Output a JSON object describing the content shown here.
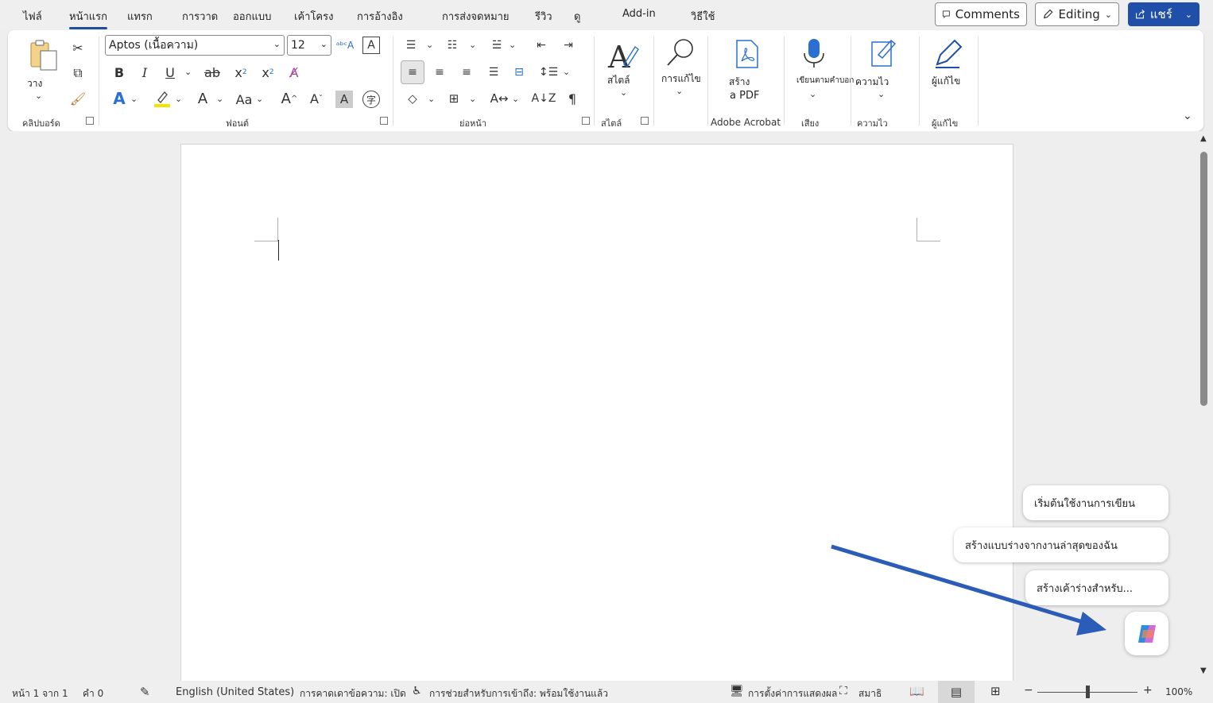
{
  "tabs": [
    {
      "label": "ไฟล์"
    },
    {
      "label": "หน้าแรก"
    },
    {
      "label": "แทรก"
    },
    {
      "label": "การวาด"
    },
    {
      "label": "ออกแบบ"
    },
    {
      "label": "เค้าโครง"
    },
    {
      "label": "การอ้างอิง"
    },
    {
      "label": "การส่งจดหมาย"
    },
    {
      "label": "รีวิว"
    },
    {
      "label": "ดู"
    },
    {
      "label": "Add-in"
    },
    {
      "label": "วิธีใช้"
    }
  ],
  "top_buttons": {
    "comments": "Comments",
    "editing": "Editing",
    "share": "แชร์"
  },
  "ribbon": {
    "clipboard": {
      "paste": "วาง",
      "label": "คลิปบอร์ด"
    },
    "font": {
      "name": "Aptos (เนื้อความ)",
      "size": "12",
      "label": "ฟอนต์"
    },
    "paragraph": {
      "label": "ย่อหน้า"
    },
    "styles": {
      "button": "สไตล์",
      "label": "สไตล์"
    },
    "editing": {
      "button": "การแก้ไข"
    },
    "acrobat": {
      "button_line1": "สร้าง",
      "button_line2": "a PDF",
      "label": "Adobe Acrobat"
    },
    "voice": {
      "button": "เขียนตามคำบอก",
      "label": "เสียง"
    },
    "sensitivity": {
      "button": "ความไว",
      "label": "ความไว"
    },
    "editor": {
      "button": "ผู้แก้ไข",
      "label": "ผู้แก้ไข"
    }
  },
  "copilot": {
    "suggestions": [
      "เริ่มต้นใช้งานการเขียน",
      "สร้างแบบร่างจากงานล่าสุดของฉัน",
      "สร้างเค้าร่างสำหรับ..."
    ]
  },
  "status": {
    "page": "หน้า 1 จาก 1",
    "words": "คำ 0",
    "language": "English (United States)",
    "predictions": "การคาดเดาข้อความ: เปิด",
    "accessibility": "การช่วยสำหรับการเข้าถึง: พร้อมใช้งานแล้ว",
    "display_settings": "การตั้งค่าการแสดงผล",
    "focus": "สมาธิ",
    "zoom": "100%"
  },
  "colors": {
    "accent": "#1f4fa8",
    "arrow": "#2b5cb8"
  }
}
